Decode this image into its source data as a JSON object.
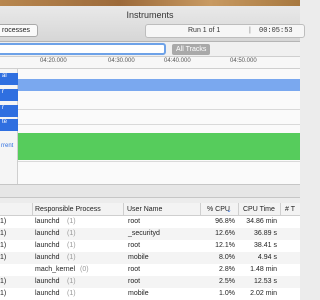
{
  "window": {
    "title": "Instruments"
  },
  "toolbar": {
    "processes_label": "rocesses",
    "run_label": "Run 1 of 1",
    "separator": "|",
    "timer": "00:05:53"
  },
  "filter": {
    "all_tracks_label": "All Tracks"
  },
  "timeline": {
    "ticks": [
      "04:20.000",
      "04:30.000",
      "04:40.000",
      "04:50.000"
    ]
  },
  "tracks": {
    "labels": [
      "al",
      "r",
      "r",
      "te",
      "rrent"
    ]
  },
  "table": {
    "headers": {
      "responsible_process": "Responsible Process",
      "user_name": "User Name",
      "cpu_pct": "% CPU",
      "cpu_time": "CPU Time",
      "threads": "# T"
    },
    "rows": [
      {
        "pid": "1)",
        "process": "launchd",
        "count": "(1)",
        "user": "root",
        "cpu": "96.8%",
        "time": "34.86 min"
      },
      {
        "pid": "1)",
        "process": "launchd",
        "count": "(1)",
        "user": "_securityd",
        "cpu": "12.6%",
        "time": "36.89 s"
      },
      {
        "pid": "1)",
        "process": "launchd",
        "count": "(1)",
        "user": "root",
        "cpu": "12.1%",
        "time": "38.41 s"
      },
      {
        "pid": "1)",
        "process": "launchd",
        "count": "(1)",
        "user": "mobile",
        "cpu": "8.0%",
        "time": "4.94 s"
      },
      {
        "pid": "",
        "process": "mach_kernel",
        "count": "(0)",
        "user": "root",
        "cpu": "2.8%",
        "time": "1.48 min"
      },
      {
        "pid": "1)",
        "process": "launchd",
        "count": "(1)",
        "user": "root",
        "cpu": "2.5%",
        "time": "12.53 s"
      },
      {
        "pid": "1)",
        "process": "launchd",
        "count": "(1)",
        "user": "mobile",
        "cpu": "1.0%",
        "time": "2.02 min"
      }
    ]
  }
}
